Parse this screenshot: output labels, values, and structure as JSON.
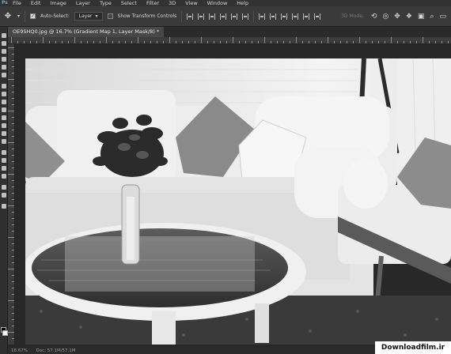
{
  "menu": {
    "app_logo": "Ps",
    "items": [
      "File",
      "Edit",
      "Image",
      "Layer",
      "Type",
      "Select",
      "Filter",
      "3D",
      "View",
      "Window",
      "Help"
    ]
  },
  "options_bar": {
    "tool_icon": "move-tool-icon",
    "auto_select_label": "Auto-Select:",
    "auto_select_checked": true,
    "auto_select_target": "Layer",
    "show_transform_label": "Show Transform Controls",
    "show_transform_checked": false,
    "mode_3d_label": "3D Mode:"
  },
  "document": {
    "tab_title": "OE9SHQ0.jpg @ 16.7% (Gradient Map 1, Layer Mask/8) *"
  },
  "status": {
    "zoom": "16.67%",
    "doc_size": "Doc: 57.1M/57.1M"
  },
  "watermark": "Downloadfilm.ir"
}
